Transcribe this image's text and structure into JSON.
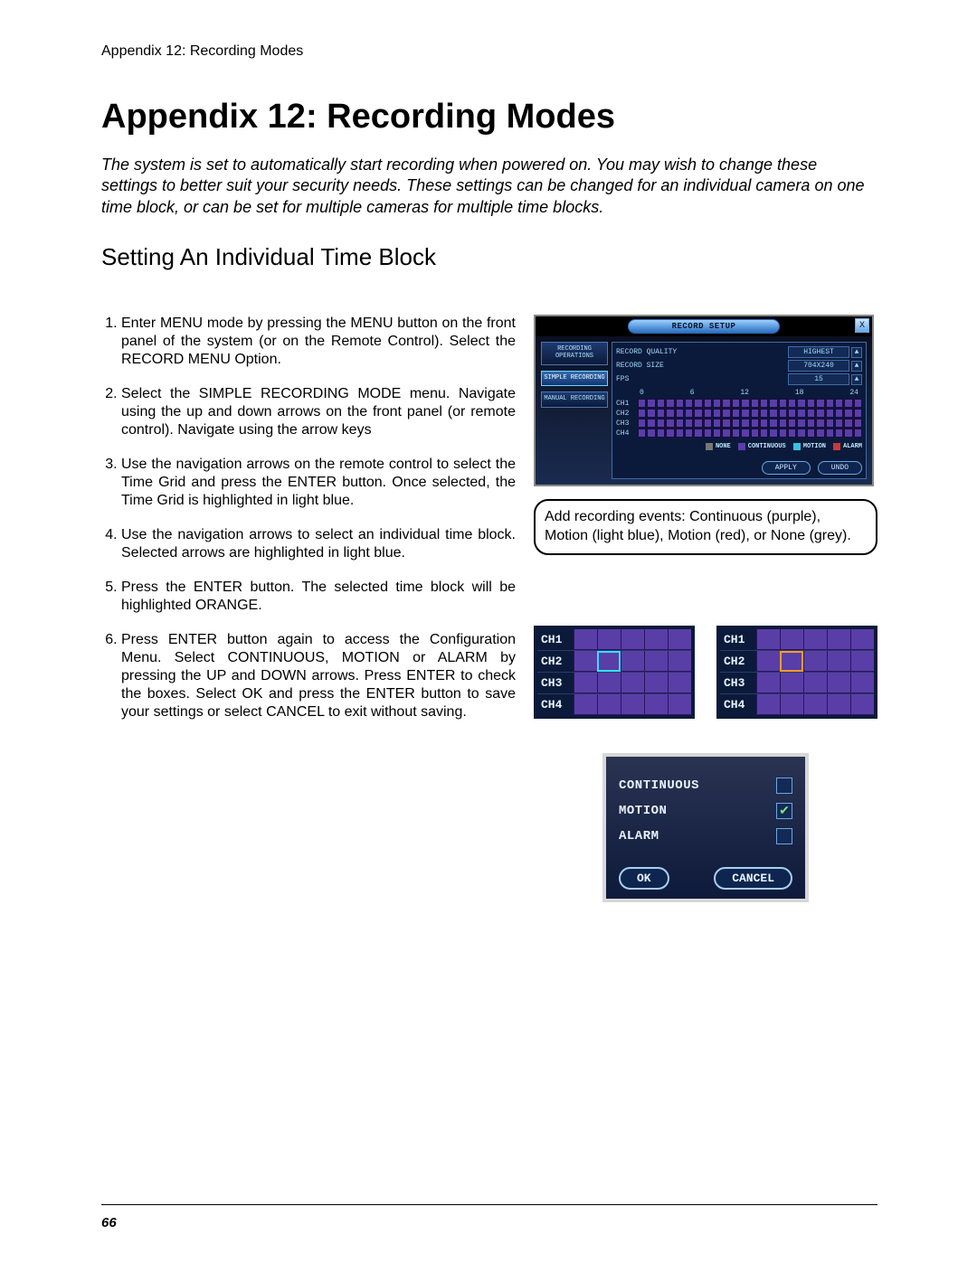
{
  "running_header": "Appendix 12: Recording Modes",
  "title": "Appendix 12: Recording Modes",
  "intro": "The system is set to automatically start recording when powered on. You may wish to change these settings to better suit your security needs. These settings can be changed for an individual camera on one time block, or can be set for multiple cameras for multiple time blocks.",
  "section_title": "Setting An Individual Time Block",
  "steps": [
    "Enter MENU mode by pressing the MENU button on the front panel of the system (or on the Remote Control). Select the RECORD MENU Option.",
    "Select the SIMPLE RECORDING MODE menu. Navigate using the up and down arrows on the front panel (or remote control). Navigate using the arrow keys",
    "Use the navigation arrows on the remote control to select the Time Grid and press the ENTER button. Once selected, the Time Grid is highlighted in light blue.",
    "Use the navigation arrows to select an individual time block. Selected arrows are highlighted in light blue.",
    "Press the ENTER button. The selected time block will be highlighted ORANGE.",
    "Press ENTER button again to access the Configuration Menu. Select CONTINUOUS, MOTION or ALARM by pressing the UP and DOWN arrows. Press ENTER to check the boxes. Select OK and press the ENTER button to save your settings or select CANCEL to exit without saving."
  ],
  "setup": {
    "title": "RECORD SETUP",
    "close": "X",
    "sidebar": {
      "items": [
        "RECORDING OPERATIONS",
        "SIMPLE RECORDING",
        "MANUAL RECORDING"
      ],
      "selected_index": 1
    },
    "options": [
      {
        "label": "RECORD QUALITY",
        "value": "HIGHEST"
      },
      {
        "label": "RECORD SIZE",
        "value": "704X240"
      },
      {
        "label": "FPS",
        "value": "15"
      }
    ],
    "time_ticks": [
      "0",
      "6",
      "12",
      "18",
      "24"
    ],
    "channels": [
      "CH1",
      "CH2",
      "CH3",
      "CH4"
    ],
    "legend": [
      {
        "key": "NONE",
        "class": "sw-none"
      },
      {
        "key": "CONTINUOUS",
        "class": "sw-cont"
      },
      {
        "key": "MOTION",
        "class": "sw-mot"
      },
      {
        "key": "ALARM",
        "class": "sw-alm"
      }
    ],
    "buttons": {
      "apply": "APPLY",
      "undo": "UNDO"
    }
  },
  "callout": "Add recording events: Continuous (purple), Motion (light blue), Motion (red), or None (grey).",
  "mini": {
    "channels": [
      "CH1",
      "CH2",
      "CH3",
      "CH4"
    ],
    "left_sel": {
      "row": 1,
      "col": 1,
      "class": "sel-cyan"
    },
    "right_sel": {
      "row": 1,
      "col": 1,
      "class": "sel-orange"
    }
  },
  "cfg": {
    "items": [
      {
        "label": "CONTINUOUS",
        "checked": false
      },
      {
        "label": "MOTION",
        "checked": true
      },
      {
        "label": "ALARM",
        "checked": false
      }
    ],
    "ok": "OK",
    "cancel": "CANCEL"
  },
  "page_number": "66"
}
